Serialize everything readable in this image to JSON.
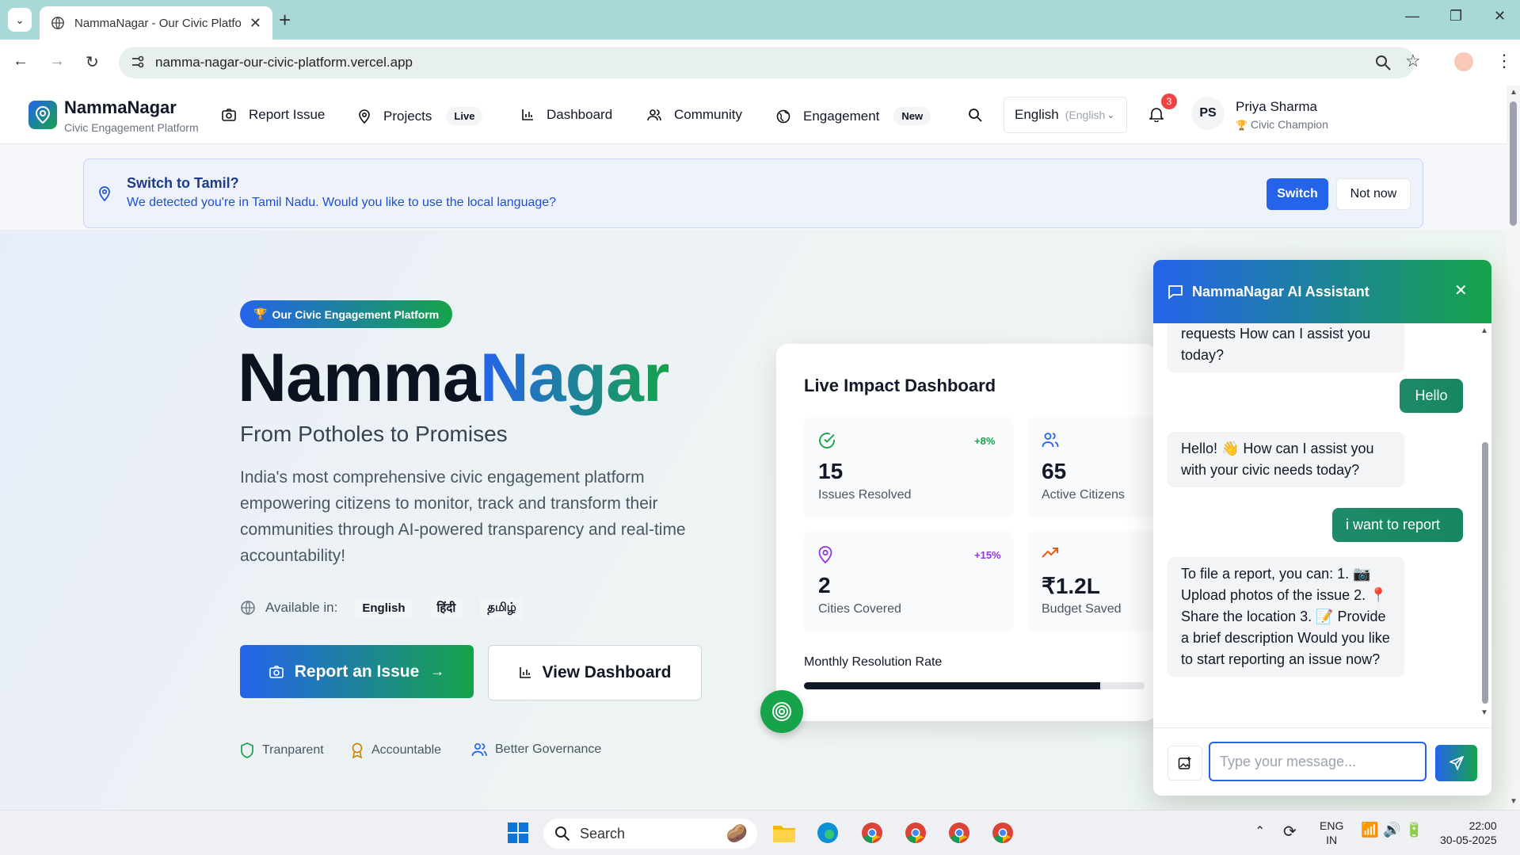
{
  "browser": {
    "tab_title": "NammaNagar - Our Civic Platform",
    "url": "namma-nagar-our-civic-platform.vercel.app"
  },
  "header": {
    "brand": "NammaNagar",
    "brand_sub": "Civic Engagement Platform",
    "nav": {
      "report": "Report Issue",
      "projects": "Projects",
      "projects_badge": "Live",
      "dashboard": "Dashboard",
      "community": "Community",
      "engagement": "Engagement",
      "engagement_badge": "New"
    },
    "language": "English",
    "language_hint": "(English",
    "notifications": "3",
    "avatar_initials": "PS",
    "user_name": "Priya Sharma",
    "user_role": "Civic Champion"
  },
  "banner": {
    "title": "Switch to Tamil?",
    "text": "We detected you're in Tamil Nadu. Would you like to use the local language?",
    "switch_label": "Switch",
    "notnow_label": "Not now"
  },
  "hero": {
    "badge": "Our Civic Engagement Platform",
    "title_part1": "Namma",
    "title_part2": "Nagar",
    "subtitle": "From Potholes to Promises",
    "description": "India's most comprehensive civic engagement platform empowering citizens to monitor, track and transform their communities through AI-powered transparency and real-time accountability!",
    "available_label": "Available in:",
    "languages": [
      "English",
      "हिंदी",
      "தமிழ்"
    ],
    "report_btn": "Report an Issue",
    "view_btn": "View Dashboard",
    "trust": [
      "Tranparent",
      "Accountable",
      "Better Governance"
    ]
  },
  "dashboard": {
    "title": "Live Impact Dashboard",
    "stats": [
      {
        "value": "15",
        "label": "Issues Resolved",
        "delta": "+8%"
      },
      {
        "value": "65",
        "label": "Active Citizens",
        "delta": ""
      },
      {
        "value": "2",
        "label": "Cities Covered",
        "delta": "+15%"
      },
      {
        "value": "₹1.2L",
        "label": "Budget Saved",
        "delta": ""
      }
    ],
    "rate_label": "Monthly Resolution Rate",
    "rate_fraction": 0.87
  },
  "chat": {
    "title": "NammaNagar AI Assistant",
    "messages": [
      {
        "role": "bot",
        "text": "requests How can I assist you today?"
      },
      {
        "role": "user",
        "text": "Hello"
      },
      {
        "role": "bot",
        "text": "Hello! 👋 How can I assist you with your civic needs today?"
      },
      {
        "role": "user",
        "text": "i want to report"
      },
      {
        "role": "bot",
        "text": "To file a report, you can: 1. 📷 Upload photos of the issue 2. 📍 Share the location 3. 📝 Provide a brief description Would you like to start reporting an issue now?"
      }
    ],
    "input_placeholder": "Type your message..."
  },
  "taskbar": {
    "search_label": "Search",
    "lang_line1": "ENG",
    "lang_line2": "IN",
    "time": "22:00",
    "date": "30-05-2025"
  },
  "colors": {
    "primary_blue": "#2563eb",
    "primary_green": "#16a34a",
    "tab_bar": "#a8d8d8"
  }
}
